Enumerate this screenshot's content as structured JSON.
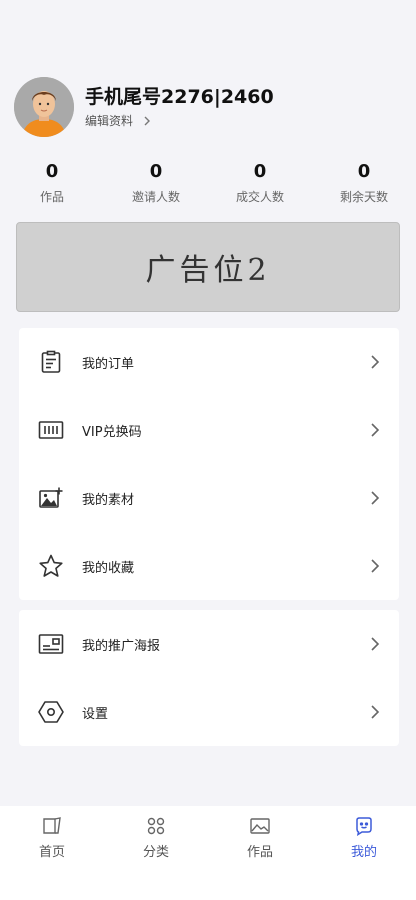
{
  "profile": {
    "name": "手机尾号2276|2460",
    "edit_label": "编辑资料"
  },
  "stats": [
    {
      "value": "0",
      "label": "作品"
    },
    {
      "value": "0",
      "label": "邀请人数"
    },
    {
      "value": "0",
      "label": "成交人数"
    },
    {
      "value": "0",
      "label": "剩余天数"
    }
  ],
  "ad_banner": {
    "text": "广告位2"
  },
  "menu_group_1": [
    {
      "label": "我的订单",
      "icon": "order-icon"
    },
    {
      "label": "VIP兑换码",
      "icon": "barcode-icon"
    },
    {
      "label": "我的素材",
      "icon": "image-add-icon"
    },
    {
      "label": "我的收藏",
      "icon": "star-icon"
    }
  ],
  "menu_group_2": [
    {
      "label": "我的推广海报",
      "icon": "poster-icon"
    },
    {
      "label": "设置",
      "icon": "settings-icon"
    }
  ],
  "tabbar": {
    "items": [
      {
        "label": "首页",
        "icon": "home-icon"
      },
      {
        "label": "分类",
        "icon": "grid-icon"
      },
      {
        "label": "作品",
        "icon": "picture-icon"
      },
      {
        "label": "我的",
        "icon": "profile-icon"
      }
    ],
    "active_index": 3,
    "active_color": "#3d5bd9"
  }
}
